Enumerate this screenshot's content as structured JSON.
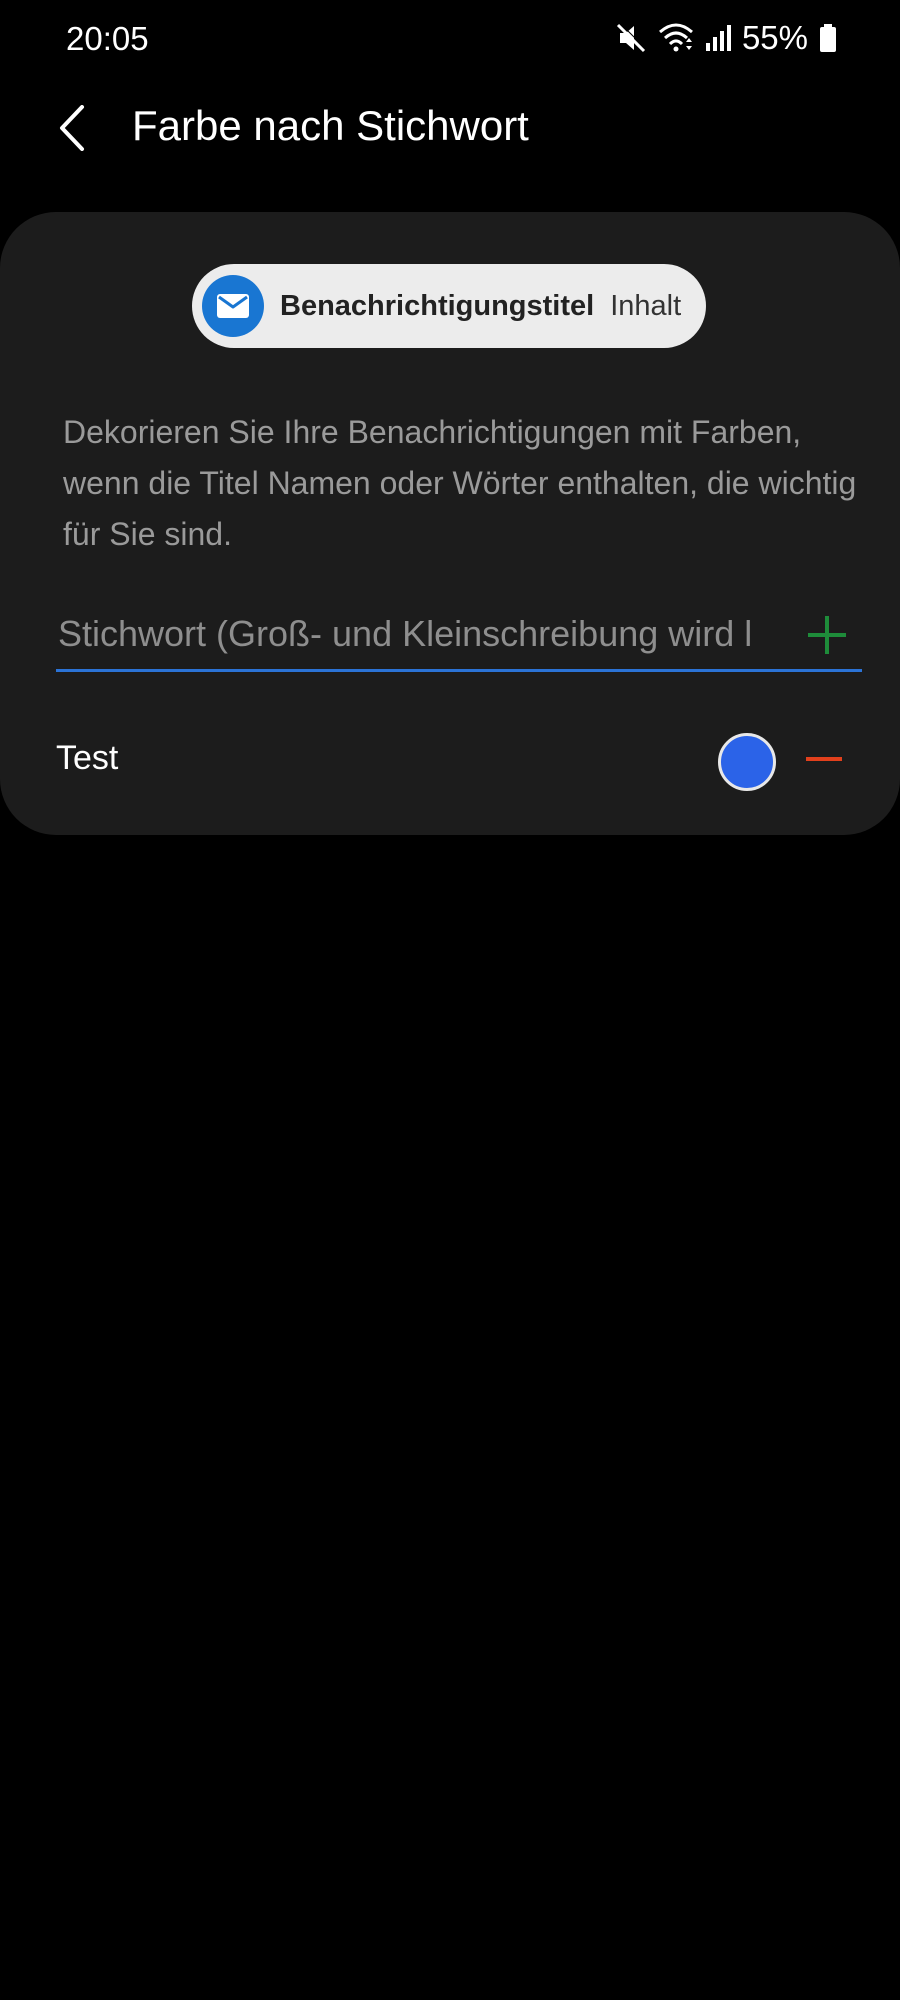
{
  "status_bar": {
    "time": "20:05",
    "battery_text": "55%",
    "icons": [
      "mute-icon",
      "wifi-icon",
      "signal-icon",
      "battery-icon"
    ]
  },
  "header": {
    "title": "Farbe nach Stichwort",
    "back_icon": "back-arrow-icon"
  },
  "preview": {
    "icon": "mail-icon",
    "title": "Benachrichtigungstitel",
    "content": "Inhalt"
  },
  "description": "Dekorieren Sie Ihre Benachrichtigungen mit Farben, wenn die Titel Namen oder Wörter enthalten, die wichtig für Sie sind.",
  "keyword_input": {
    "placeholder": "Stichwort (Groß- und Kleinschreibung wird l",
    "value": "",
    "add_icon": "plus-icon"
  },
  "keywords": [
    {
      "label": "Test",
      "color": "#2b63e8",
      "remove_icon": "minus-icon"
    }
  ],
  "colors": {
    "background": "#000000",
    "card": "#1c1c1c",
    "accent": "#2b73d6",
    "add_green": "#1e8c3a",
    "remove_red": "#e2401c",
    "mail_blue": "#1976d2"
  }
}
